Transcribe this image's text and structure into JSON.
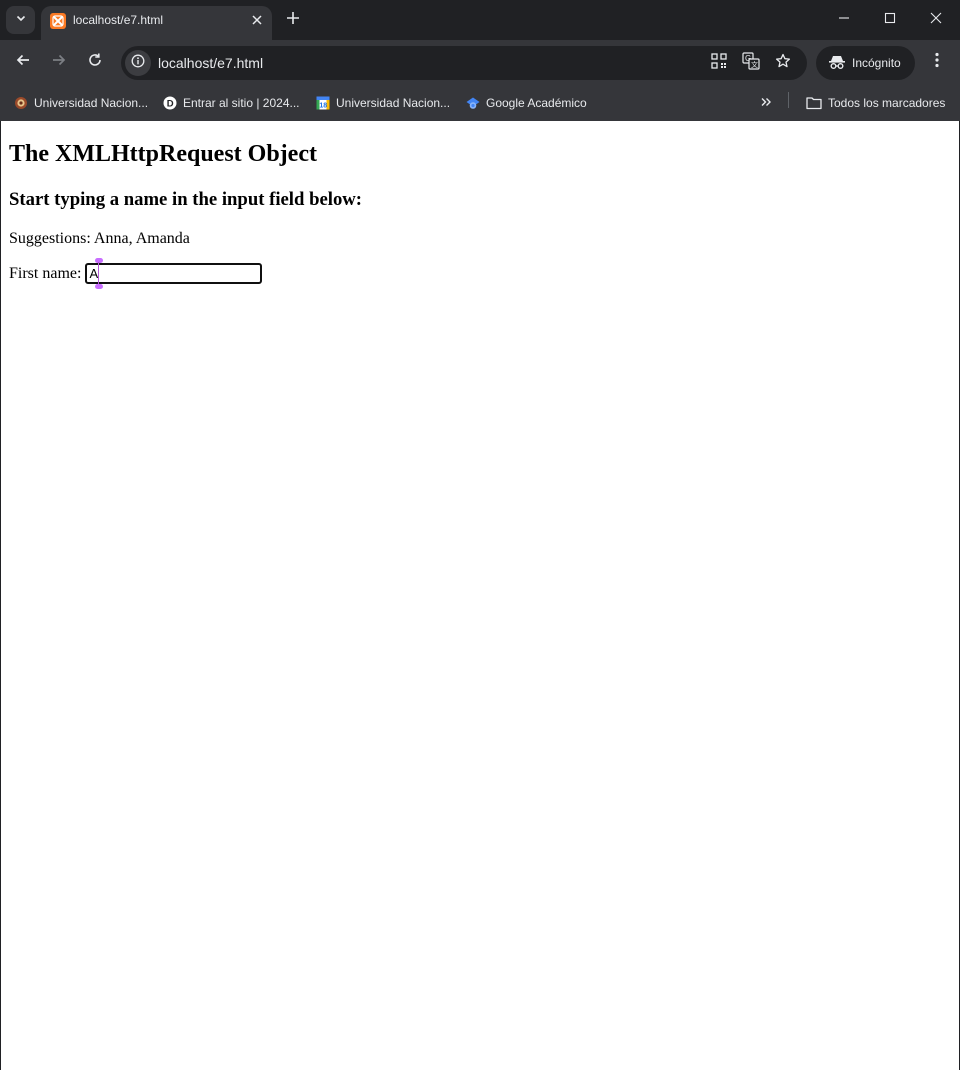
{
  "tab": {
    "title": "localhost/e7.html",
    "favicon": "xampp-icon"
  },
  "toolbar": {
    "url": "localhost/e7.html",
    "incognito_label": "Incógnito"
  },
  "bookmarks": [
    {
      "label": "Universidad Nacion...",
      "icon": "university-seal-icon"
    },
    {
      "label": "Entrar al sitio | 2024...",
      "icon": "moodle-d-icon"
    },
    {
      "label": "Universidad Nacion...",
      "icon": "calendar-icon"
    },
    {
      "label": "Google Académico",
      "icon": "scholar-cap-icon"
    }
  ],
  "all_bookmarks_label": "Todos los marcadores",
  "page": {
    "heading": "The XMLHttpRequest Object",
    "subheading": "Start typing a name in the input field below:",
    "suggestions_label": "Suggestions:",
    "suggestions_value": "Anna, Amanda",
    "first_name_label": "First name:",
    "first_name_value": "A"
  },
  "colors": {
    "chrome_dark": "#202124",
    "chrome_toolbar": "#35363a",
    "favicon_orange": "#fb7a24",
    "caret_purple": "#c86dff"
  }
}
